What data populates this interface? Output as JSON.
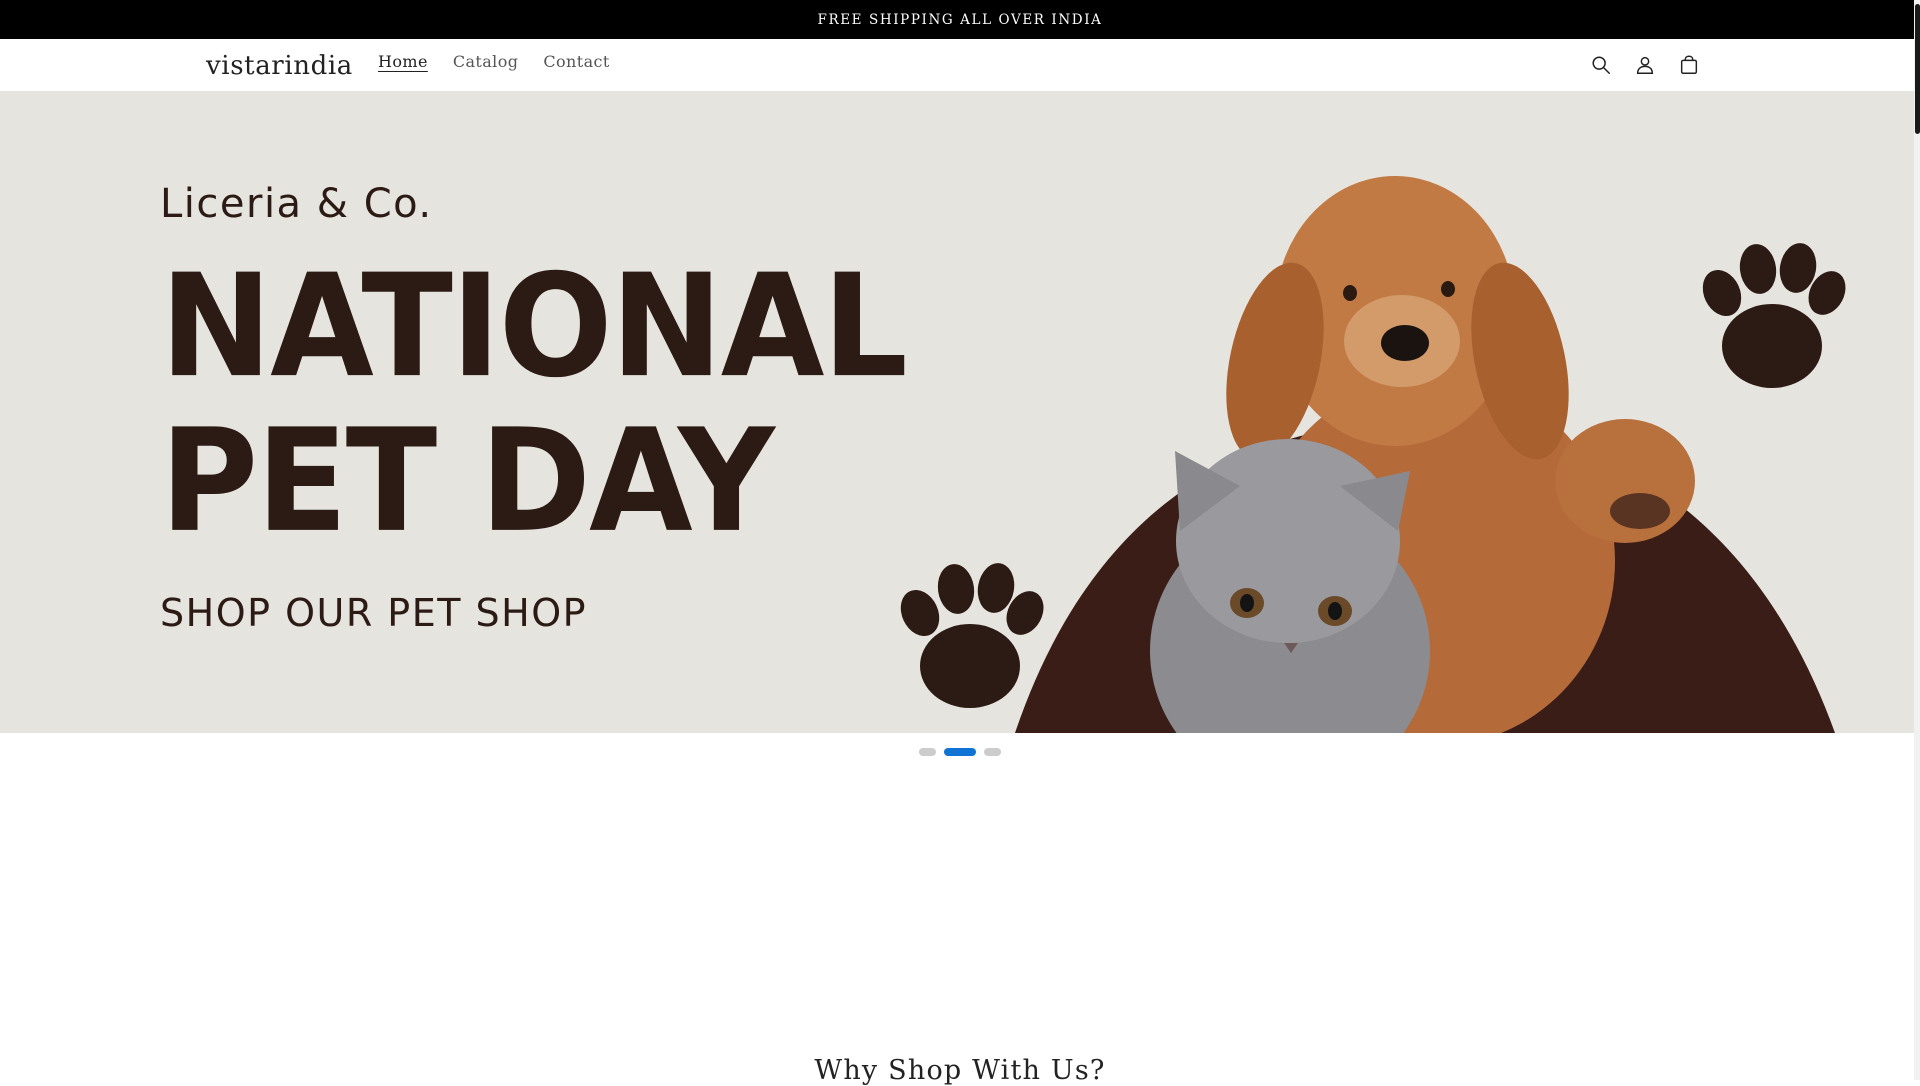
{
  "announcement": {
    "text": "FREE SHIPPING ALL OVER INDIA"
  },
  "header": {
    "logo": "vistarindia",
    "nav": [
      {
        "label": "Home",
        "active": true
      },
      {
        "label": "Catalog",
        "active": false
      },
      {
        "label": "Contact",
        "active": false
      }
    ],
    "icons": [
      "search-icon",
      "account-icon",
      "cart-icon"
    ]
  },
  "hero": {
    "brand": "Liceria & Co.",
    "title_line1": "NATIONAL",
    "title_line2": "PET DAY",
    "cta": "SHOP OUR PET SHOP",
    "colors": {
      "background": "#e6e4de",
      "text": "#2c1a14",
      "accent": "#3a1d16"
    }
  },
  "slider": {
    "count": 3,
    "active_index": 1,
    "active_color": "#1173d4"
  },
  "section": {
    "heading": "Why Shop With Us?"
  }
}
